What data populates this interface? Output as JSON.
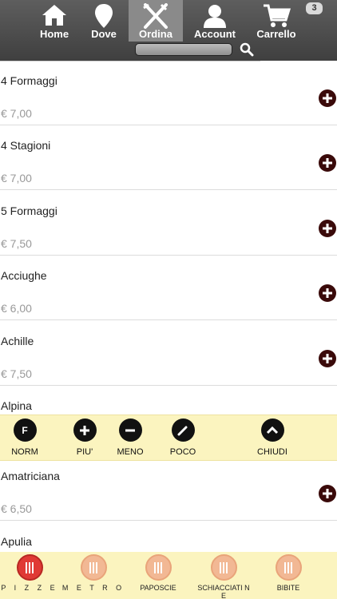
{
  "nav": {
    "items": [
      {
        "label": "Home",
        "icon": "home-icon",
        "active": false
      },
      {
        "label": "Dove",
        "icon": "location-pin-icon",
        "active": false
      },
      {
        "label": "Ordina",
        "icon": "cutlery-icon",
        "active": true
      },
      {
        "label": "Account",
        "icon": "user-icon",
        "active": false
      },
      {
        "label": "Carrello",
        "icon": "cart-icon",
        "active": false
      }
    ],
    "cart_count": "3",
    "search_placeholder": ""
  },
  "products": [
    {
      "name": "4 Formaggi",
      "price": "€ 7,00"
    },
    {
      "name": "4 Stagioni",
      "price": "€ 7,00"
    },
    {
      "name": "5 Formaggi",
      "price": "€ 7,50"
    },
    {
      "name": "Acciughe",
      "price": "€ 6,00"
    },
    {
      "name": "Achille",
      "price": "€ 7,50"
    },
    {
      "name": "Alpina",
      "price": ""
    },
    {
      "name": "Amatriciana",
      "price": "€ 6,50"
    },
    {
      "name": "Apulia",
      "price": ""
    }
  ],
  "qty_toolbar": {
    "items": [
      {
        "label": "NORM",
        "glyph": "F",
        "icon": "norm-icon"
      },
      {
        "label": "PIU'",
        "glyph": "+",
        "icon": "plus-icon"
      },
      {
        "label": "MENO",
        "glyph": "−",
        "icon": "minus-icon"
      },
      {
        "label": "POCO",
        "glyph": "pencil",
        "icon": "pencil-icon"
      },
      {
        "label": "CHIUDI",
        "glyph": "^",
        "icon": "chevron-up-icon"
      }
    ]
  },
  "categories": [
    {
      "label": "P I Z Z E",
      "active": true
    },
    {
      "label": "M E T R O",
      "active": false
    },
    {
      "label": "PAPOSCIE",
      "active": false
    },
    {
      "label": "SCHIACCIATI NE",
      "active": false
    },
    {
      "label": "BIBITE",
      "active": false
    }
  ],
  "colors": {
    "topbar": "#4a4a4a",
    "active_tab": "#8a8a8a",
    "toolbar_bg": "#fbf4bf",
    "add_button": "#3a0a0a",
    "price_text": "#999999",
    "active_category": "#e03a35"
  }
}
